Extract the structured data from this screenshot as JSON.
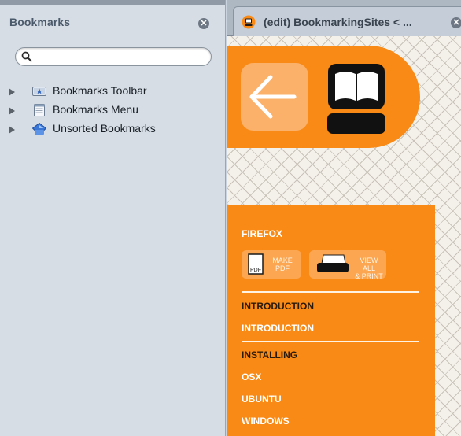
{
  "sidebar": {
    "title": "Bookmarks",
    "close_icon": "close-icon",
    "search": {
      "value": "",
      "placeholder": ""
    },
    "items": [
      {
        "label": "Bookmarks Toolbar",
        "icon": "bookmarks-toolbar-icon"
      },
      {
        "label": "Bookmarks Menu",
        "icon": "bookmarks-menu-icon"
      },
      {
        "label": "Unsorted Bookmarks",
        "icon": "unsorted-bookmarks-icon"
      }
    ]
  },
  "tab": {
    "title": "(edit) BookmarkingSites < ...",
    "favicon": "flossmanuals-icon"
  },
  "page": {
    "accent_color": "#f98a15",
    "section_heading": "FIREFOX",
    "make_pdf": {
      "line1": "MAKE",
      "line2": "PDF"
    },
    "view_all": {
      "line1": "VIEW ALL",
      "line2": "& PRINT"
    },
    "nav": [
      {
        "label": "INTRODUCTION",
        "style": "dark"
      },
      {
        "label": "INTRODUCTION",
        "style": "light"
      },
      {
        "label": "INSTALLING",
        "style": "dark"
      },
      {
        "label": "OSX",
        "style": "light"
      },
      {
        "label": "UBUNTU",
        "style": "light"
      },
      {
        "label": "WINDOWS",
        "style": "light"
      }
    ]
  }
}
